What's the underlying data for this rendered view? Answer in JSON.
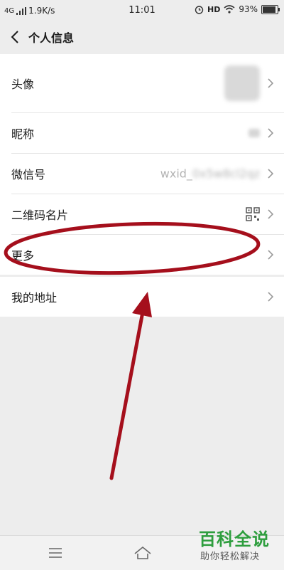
{
  "status_bar": {
    "network": "4G",
    "speed": "1.9K/s",
    "time": "11:01",
    "hd": "HD",
    "battery_percent": "93%",
    "battery_level": 0.93
  },
  "header": {
    "title": "个人信息"
  },
  "groups": [
    {
      "items": [
        {
          "label": "头像"
        },
        {
          "label": "昵称"
        },
        {
          "label": "微信号",
          "value": "wxid_",
          "value_obscured": "0x5w8cl2qz"
        },
        {
          "label": "二维码名片"
        },
        {
          "label": "更多"
        }
      ]
    },
    {
      "items": [
        {
          "label": "我的地址"
        }
      ]
    }
  ],
  "watermark": {
    "title": "百科全说",
    "subtitle": "助你轻松解决"
  },
  "colors": {
    "annotation": "#a50f1c",
    "watermark_green": "#2e9e3e",
    "background": "#ededed"
  }
}
